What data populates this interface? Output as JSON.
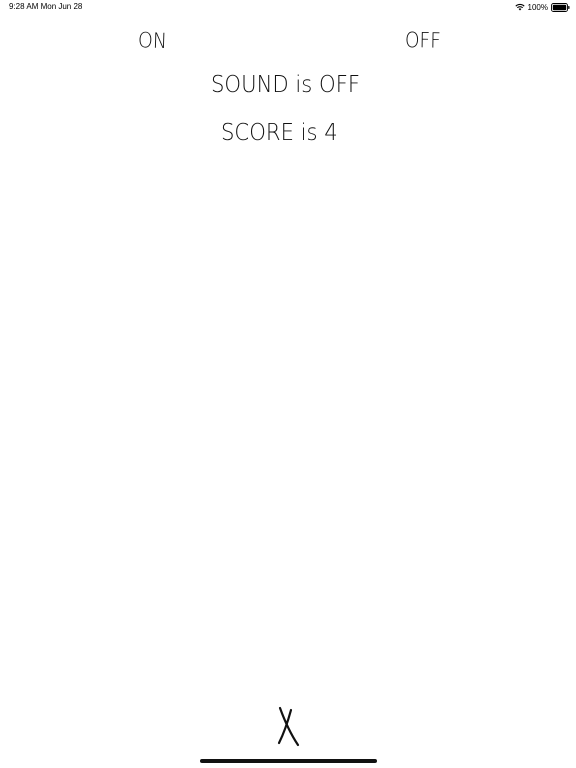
{
  "status_bar": {
    "time_date": "9:28 AM   Mon Jun 28",
    "battery_percent": "100%",
    "icons": [
      "wifi-icon",
      "battery-icon"
    ]
  },
  "sound_toggle": {
    "on_label": "ON",
    "off_label": "OFF"
  },
  "status": {
    "sound_text": "SOUND is OFF",
    "score_text": "SCORE is 4"
  },
  "close_button": {
    "icon": "close-x-icon"
  },
  "colors": {
    "background": "#ffffff",
    "ink": "#111111"
  }
}
